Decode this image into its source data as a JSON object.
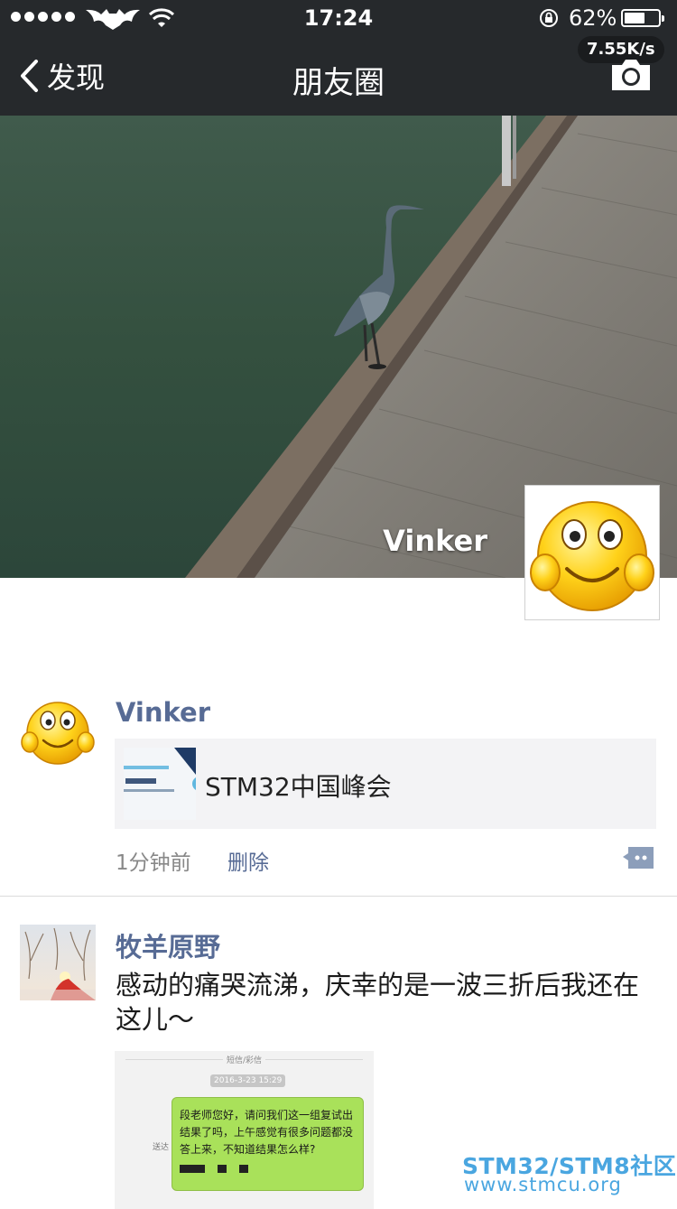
{
  "status_bar": {
    "time": "17:24",
    "battery_percent": "62%",
    "battery_level": 0.62,
    "net_speed": "7.55K/s",
    "icons": [
      "signal-dots-icon",
      "carrier-logo-icon",
      "wifi-icon",
      "rotation-lock-icon",
      "battery-icon"
    ]
  },
  "nav": {
    "back_label": "发现",
    "title": "朋友圈",
    "right_icon": "camera-icon"
  },
  "cover": {
    "username": "Vinker"
  },
  "posts": [
    {
      "username": "Vinker",
      "link_card": {
        "title": "STM32中国峰会"
      },
      "time": "1分钟前",
      "delete_label": "删除",
      "comment_icon": "comment-icon"
    },
    {
      "username": "牧羊原野",
      "text": "感动的痛哭流涕，庆幸的是一波三折后我还在这儿～",
      "screenshot": {
        "header": "短信/彩信",
        "date": "2016-3-23 15:29",
        "sent_label": "送达",
        "message": "段老师您好，请问我们这一组复试出结果了吗，上午感觉有很多问题都没答上来，不知道结果怎么样?"
      }
    }
  ],
  "watermark": {
    "line1": "STM32/STM8社区",
    "line2": "www.stmcu.org"
  },
  "colors": {
    "nav_bg": "#26292c",
    "link_name": "#576b95",
    "watermark": "#4aa6e0"
  }
}
